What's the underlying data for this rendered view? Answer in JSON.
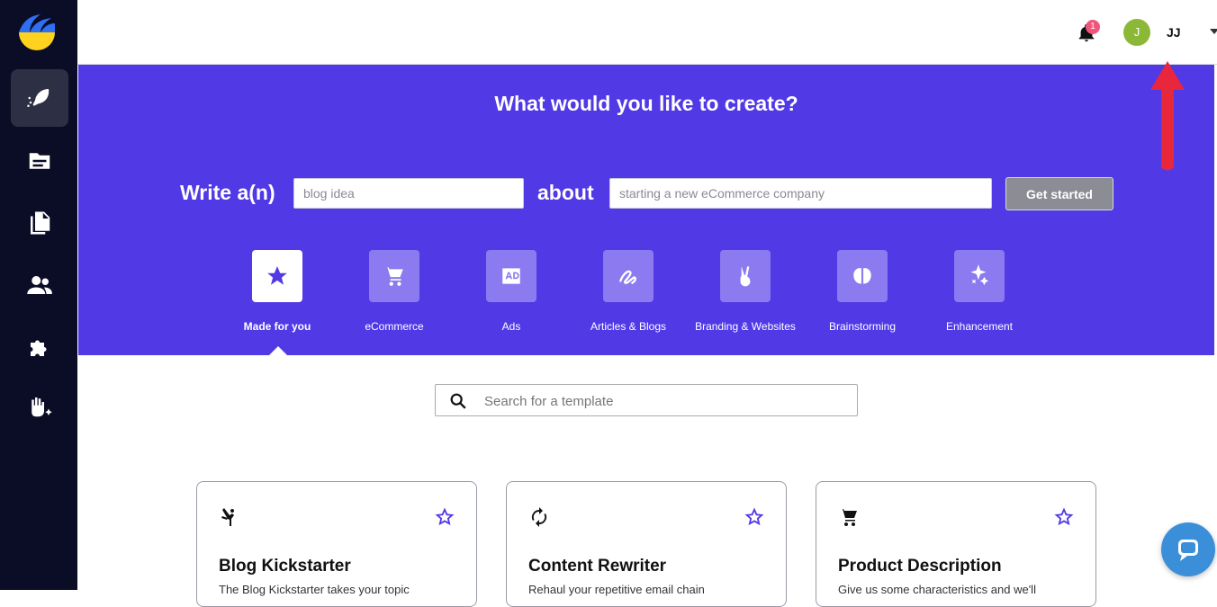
{
  "header": {
    "notifications_count": "1",
    "avatar_initial": "J",
    "user_name": "JJ"
  },
  "hero": {
    "title": "What would you like to create?",
    "write_label": "Write a(n)",
    "type_placeholder": "blog idea",
    "about_label": "about",
    "topic_placeholder": "starting a new eCommerce company",
    "button_label": "Get started"
  },
  "categories": [
    {
      "label": "Made for you",
      "icon": "star-icon",
      "active": true
    },
    {
      "label": "eCommerce",
      "icon": "cart-icon"
    },
    {
      "label": "Ads",
      "icon": "ad-icon"
    },
    {
      "label": "Articles & Blogs",
      "icon": "squiggle-icon"
    },
    {
      "label": "Branding & Websites",
      "icon": "peace-hand-icon"
    },
    {
      "label": "Brainstorming",
      "icon": "brain-icon"
    },
    {
      "label": "Enhancement",
      "icon": "sparkle-icon"
    }
  ],
  "search": {
    "placeholder": "Search for a template"
  },
  "cards": [
    {
      "title": "Blog Kickstarter",
      "description": "The Blog Kickstarter takes your topic",
      "icon": "kick-icon"
    },
    {
      "title": "Content Rewriter",
      "description": "Rehaul your repetitive email chain",
      "icon": "refresh-icon"
    },
    {
      "title": "Product Description",
      "description": "Give us some characteristics and we'll",
      "icon": "cart-icon"
    }
  ],
  "colors": {
    "sidebar": "#0b0d26",
    "hero": "#5239e6",
    "accent": "#5239e6",
    "annotation_arrow": "#e8263c"
  }
}
